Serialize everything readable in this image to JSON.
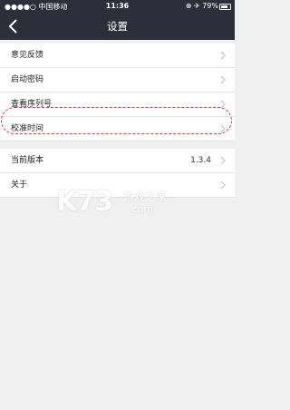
{
  "status_bar": {
    "carrier": "●●●●○ 中国移动",
    "time": "11:36",
    "battery": "⊕ ✈ 79%"
  },
  "nav": {
    "title": "设置",
    "back_icon": "chevron-left-icon"
  },
  "settings": {
    "group1": [
      {
        "label": "意见反馈"
      },
      {
        "label": "启动密码"
      },
      {
        "label": "查看序列号"
      },
      {
        "label": "校准时间"
      }
    ],
    "group2": [
      {
        "label": "当前版本",
        "value": "1.3.4"
      },
      {
        "label": "关于"
      }
    ]
  },
  "watermark": {
    "brand": "K73",
    "cn": "游戏之家",
    "domain": ".com"
  },
  "colors": {
    "header_bg": "#2c2f3a",
    "highlight": "#d9363e",
    "page_bg": "#f0f0f0"
  }
}
